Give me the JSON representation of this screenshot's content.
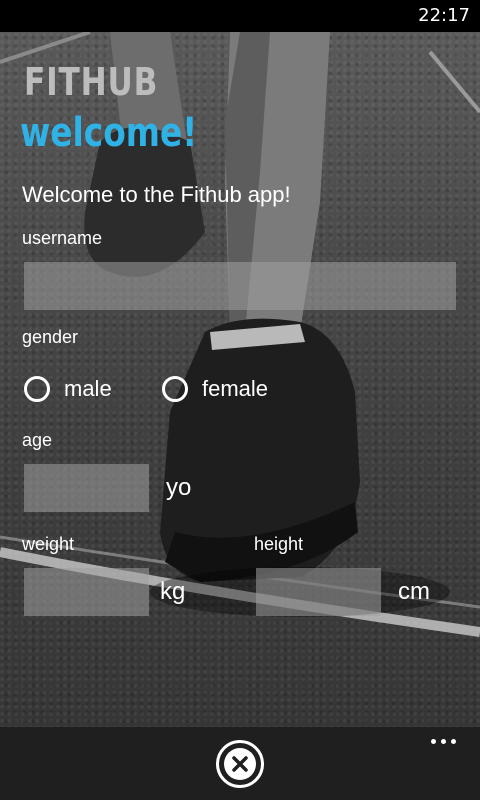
{
  "status_bar": {
    "time": "22:17"
  },
  "header": {
    "app_title": "FITHUB",
    "page_title": "welcome!"
  },
  "form": {
    "intro": "Welcome to the Fithub app!",
    "username_label": "username",
    "username_value": "",
    "gender_label": "gender",
    "gender_options": [
      {
        "label": "male",
        "selected": false
      },
      {
        "label": "female",
        "selected": false
      }
    ],
    "age_label": "age",
    "age_value": "",
    "age_unit": "yo",
    "weight_label": "weight",
    "weight_value": "",
    "weight_unit": "kg",
    "height_label": "height",
    "height_value": "",
    "height_unit": "cm"
  },
  "app_bar": {
    "close_icon": "close-icon",
    "more_icon": "more-icon"
  },
  "colors": {
    "accent": "#2fb2e6",
    "app_title": "#bcbcbc",
    "app_bar": "#1f1f1f",
    "input_bg": "#a0a0a0"
  }
}
